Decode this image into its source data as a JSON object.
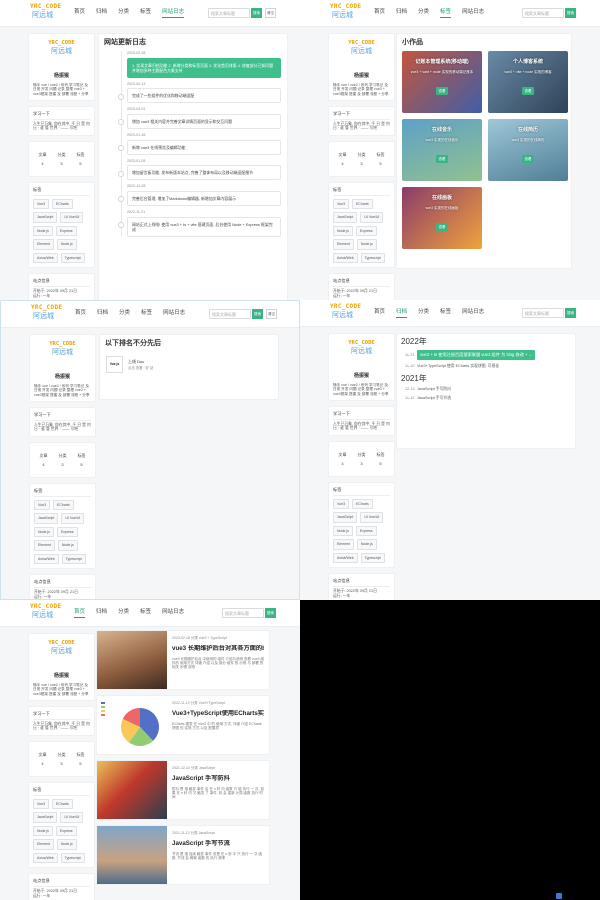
{
  "brand": {
    "top": "YRC_CODE",
    "bottom": "阿远城"
  },
  "search": {
    "placeholder": "搜索文章标题",
    "btn": "搜索",
    "btn2": "清空"
  },
  "colors": {
    "accent": "#3ab485",
    "highlight": "#3fbf8b",
    "logo_orange": "#f2a200",
    "logo_blue": "#5aa3d9"
  },
  "profile": {
    "name": "杨振猴",
    "desc": "随手 vue / vue2 / 系列 学习笔记 及 日常 开发 问题 记录 整理 vue3 + vue3框架 搭建 及 部署 流程 + 分享",
    "sect1": "学习一下",
    "sect1_text": "人生已万象, 你在其中, 千 日 是 何 日 · 谁 管 世界 · —— 写吧",
    "stats": [
      {
        "label": "文章",
        "value": "4"
      },
      {
        "label": "分类",
        "value": "3"
      },
      {
        "label": "标签",
        "value": "5"
      }
    ],
    "tags_title": "标签",
    "tags": [
      "Vue3",
      "ECharts",
      "JavaScript",
      "UI Vue/UI",
      "Node.js",
      "Express",
      "Element",
      "Node.js",
      "Axios/Web",
      "Typescript"
    ],
    "site_title": "站点信息",
    "site_line1": "开始于: 2022年 09月 21日",
    "site_line2": "运行: 一年"
  },
  "nav1": [
    "首页",
    "归档",
    "分类",
    "标签",
    "网站日志"
  ],
  "nav2": [
    "首页",
    "归档",
    "分类",
    "标签",
    "网站日志"
  ],
  "p1": {
    "title": "网站更新日志",
    "entries": [
      {
        "date": "2023-02-28",
        "text": "1. 实现文章归档功能 2. 新增分类和标签页面 3. 优化首页排版 4. 修复部分已知问题并增加多种主题配色方案支持",
        "hl": true
      },
      {
        "date": "2023-02-13",
        "text": "完成了一些组件的优化和移动端适配"
      },
      {
        "date": "2023-02-01",
        "text": "增加 vue3 相关内容并完善文章详情页面的显示和交互问题"
      },
      {
        "date": "2023-01-16",
        "text": "新增 vue3 在线预览及编辑功能"
      },
      {
        "date": "2023-01-09",
        "text": "增加留言板功能, 发布新版本站点, 完善了整体布局以及移动端适配细节"
      },
      {
        "date": "2022-12-28",
        "text": "完善后台管理, 增加了Markdown编辑器, 新增加文章内容展示"
      },
      {
        "date": "2022-11-21",
        "text": "网站正式上线啦! 使用 vue3 + ts + vite 搭建页面, 后台使用 Node + Express 框架完成"
      }
    ]
  },
  "p2": {
    "title": "小作品",
    "tiles": [
      {
        "title": "记账本管理系统(移动端)",
        "desc": "vue3 + vant + node 实现的移动端记账本",
        "btn": "查看",
        "c1": "#c4553f",
        "c2": "#3f5fa6"
      },
      {
        "title": "个人博客系统",
        "desc": "vue3 + vite + node 实现的博客",
        "btn": "查看",
        "c1": "#6a8aa6",
        "c2": "#2e4358"
      },
      {
        "title": "在线音乐",
        "desc": "vue3 实现的在线音乐",
        "btn": "查看",
        "c1": "#5fa0c8",
        "c2": "#8fc28f"
      },
      {
        "title": "在线简历",
        "desc": "vue3 实现的在线简历",
        "btn": "查看",
        "c1": "#9fc7d8",
        "c2": "#4f7f96"
      },
      {
        "title": "在线画板",
        "desc": "vue3 实现的在线画板",
        "btn": "查看",
        "c1": "#8b3b6a",
        "c2": "#f0a33c"
      }
    ]
  },
  "p3": {
    "title": "以下排名不分先后",
    "item": {
      "thumb": "Vue.js",
      "title": "上线 Doc",
      "meta": "点击 查看 · 好 站"
    }
  },
  "p4": {
    "years": [
      {
        "year": "2022年",
        "rows": [
          {
            "d": "11-21",
            "text": "vue3 + ts 使用注册百度搜索联盟 vue3 组件 为 blog 修改 + ...",
            "hl": true
          },
          {
            "d": "11-10",
            "text": "Vue3+TypeScript 使用 ECharts 实现饼图, 可视化"
          }
        ]
      },
      {
        "year": "2021年",
        "rows": [
          {
            "d": "12-10",
            "text": "JavaScript 手写防抖"
          },
          {
            "d": "11-12",
            "text": "JavaScript 手写节流"
          }
        ]
      }
    ]
  },
  "p5": {
    "articles": [
      {
        "meta": "2023-02-18   分类   vue3 + TypeScript",
        "title": "vue3 长期维护后台对其各方面的blog显示",
        "exc": "vue3 长期维护后台 中使用的 组件 介绍与说明 查看 vue3 组件的 使用方式 详细 介绍 以及 部分 组件 的 示例 与 部署 的 相关 步骤 说明",
        "thumb": "portrait"
      },
      {
        "meta": "2022-11-10   分类   Vue3+TypeScript",
        "title": "Vue3+TypeScript使用ECharts实现饼图, 可视",
        "exc": "ECharts 图表 在 Vue3 中 的 使用 方式, 详细 介绍 ECharts 饼图 的 实现 方式 以及 配置项",
        "thumb": "pie"
      },
      {
        "meta": "2021-12-10   分类   JavaScript",
        "title": "JavaScript 手写防抖",
        "exc": "防抖 是 指 触发 事件 后 在 n 秒 内 函数 只 能 执行 一 次, 如果 在 n 秒 内 又 触发 了 事件, 则 会 重新 计算 函数 执行 时间",
        "thumb": "onepiece"
      },
      {
        "meta": "2021-11-12   分类   JavaScript",
        "title": "JavaScript 手写节流",
        "exc": "节流 是 指 连续 触发 事件 但是 在 n 秒 中 只 执行 一 次 函数, 节流 会 稀释 函数 的 执行 频率",
        "thumb": "landscape"
      }
    ]
  },
  "chart_data": {
    "type": "pie",
    "values": [
      38,
      22,
      22,
      18
    ],
    "colors": [
      "#5470c6",
      "#91cc75",
      "#fac858",
      "#ee6666"
    ]
  }
}
